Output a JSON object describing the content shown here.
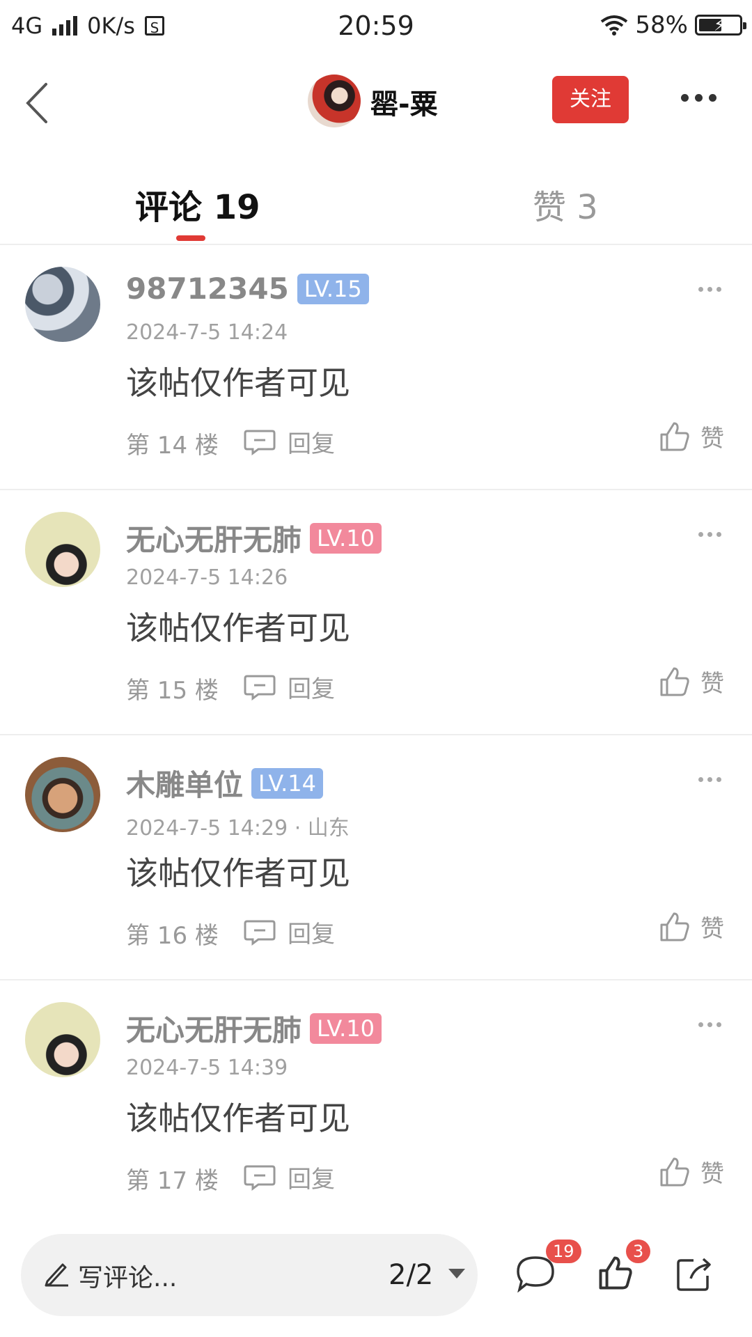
{
  "status_bar": {
    "network": "4G",
    "speed": "0K/s",
    "sim_icon": "S",
    "time": "20:59",
    "battery_percent": "58%",
    "battery_level": 0.58
  },
  "header": {
    "username": "罂-粟",
    "follow_label": "关注"
  },
  "tabs": [
    {
      "label": "评论 19",
      "active": true
    },
    {
      "label": "赞 3",
      "active": false
    }
  ],
  "comments": [
    {
      "username": "98712345",
      "level": "LV.15",
      "level_color": "#8fb3ea",
      "time": "2024-7-5 14:24",
      "text": "该帖仅作者可见",
      "floor": "第 14 楼",
      "reply_label": "回复",
      "like_label": "赞",
      "avatar": "cloud-avatar"
    },
    {
      "username": "无心无肝无肺",
      "level": "LV.10",
      "level_color": "#f2899c",
      "time": "2024-7-5 14:26",
      "text": "该帖仅作者可见",
      "floor": "第 15 楼",
      "reply_label": "回复",
      "like_label": "赞",
      "avatar": "girl-avatar"
    },
    {
      "username": "木雕单位",
      "level": "LV.14",
      "level_color": "#8fb3ea",
      "time": "2024-7-5 14:29 · 山东",
      "text": "该帖仅作者可见",
      "floor": "第 16 楼",
      "reply_label": "回复",
      "like_label": "赞",
      "avatar": "man-avatar"
    },
    {
      "username": "无心无肝无肺",
      "level": "LV.10",
      "level_color": "#f2899c",
      "time": "2024-7-5 14:39",
      "text": "该帖仅作者可见",
      "floor": "第 17 楼",
      "reply_label": "回复",
      "like_label": "赞",
      "avatar": "girl-avatar"
    }
  ],
  "bottom_bar": {
    "comment_placeholder": "写评论...",
    "page_indicator": "2/2",
    "comment_count": "19",
    "like_count": "3"
  }
}
